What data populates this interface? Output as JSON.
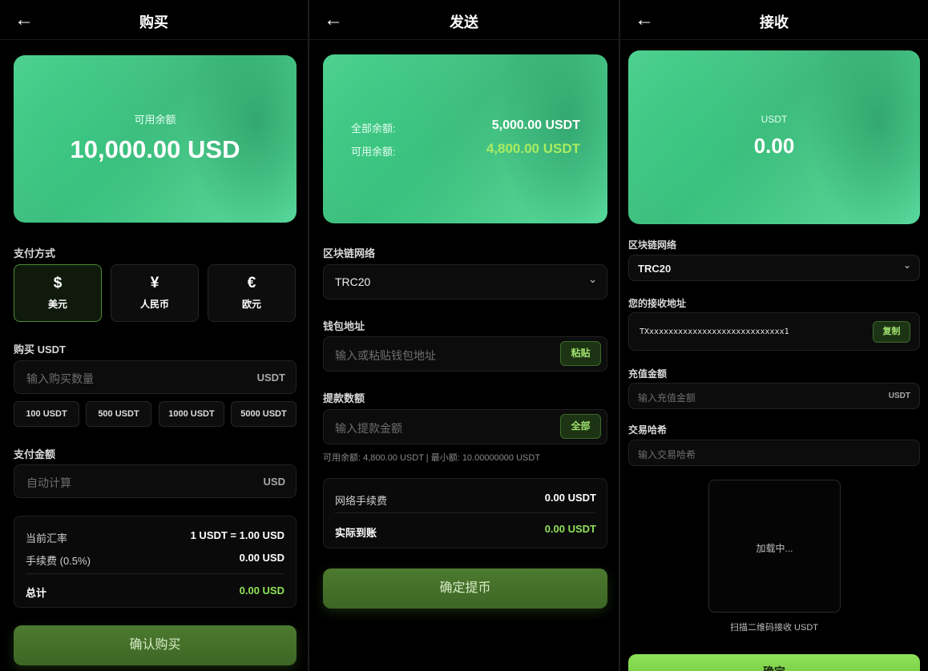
{
  "buy": {
    "title": "购买",
    "balance_label": "可用余额",
    "balance_value": "10,000.00 USD",
    "payment_label": "支付方式",
    "payment_methods": [
      {
        "symbol": "$",
        "label": "美元",
        "active": true
      },
      {
        "symbol": "¥",
        "label": "人民币",
        "active": false
      },
      {
        "symbol": "€",
        "label": "欧元",
        "active": false
      }
    ],
    "buy_label": "购买 USDT",
    "amount_placeholder": "输入购买数量",
    "amount_unit": "USDT",
    "quick_amounts": [
      "100 USDT",
      "500 USDT",
      "1000 USDT",
      "5000 USDT"
    ],
    "pay_amount_label": "支付金额",
    "pay_placeholder": "自动计算",
    "pay_unit": "USD",
    "rate_label": "当前汇率",
    "rate_value": "1 USDT = 1.00 USD",
    "fee_label": "手续费 (0.5%)",
    "fee_value": "0.00 USD",
    "total_label": "总计",
    "total_value": "0.00 USD",
    "confirm_label": "确认购买"
  },
  "send": {
    "title": "发送",
    "total_balance_label": "全部余额:",
    "total_balance_value": "5,000.00 USDT",
    "avail_balance_label": "可用余额:",
    "avail_balance_value": "4,800.00 USDT",
    "network_label": "区块链网络",
    "network_value": "TRC20",
    "wallet_label": "钱包地址",
    "wallet_placeholder": "输入或粘贴钱包地址",
    "paste_label": "粘贴",
    "amount_label": "提款数额",
    "amount_placeholder": "输入提款金额",
    "all_label": "全部",
    "hint": "可用余额: 4,800.00 USDT | 最小额: 10.00000000 USDT",
    "fee_label": "网络手续费",
    "fee_value": "0.00 USDT",
    "actual_label": "实际到账",
    "actual_value": "0.00 USDT",
    "confirm_label": "确定提币"
  },
  "receive": {
    "title": "接收",
    "currency": "USDT",
    "balance": "0.00",
    "network_label": "区块链网络",
    "network_value": "TRC20",
    "address_label": "您的接收地址",
    "address_value": "TXxxxxxxxxxxxxxxxxxxxxxxxxxxxx1",
    "copy_label": "复制",
    "deposit_label": "充值金额",
    "deposit_placeholder": "输入充值金额",
    "deposit_unit": "USDT",
    "hash_label": "交易哈希",
    "hash_placeholder": "输入交易哈希",
    "qr_loading": "加载中...",
    "qr_caption": "扫描二维码接收 USDT",
    "confirm_label": "确定"
  },
  "icons": {
    "back": "←",
    "chevron": "⌄"
  },
  "colors": {
    "accent_green": "#8fe35a",
    "card_green": "#4ccb8b",
    "button_green": "#4c7a2e"
  }
}
